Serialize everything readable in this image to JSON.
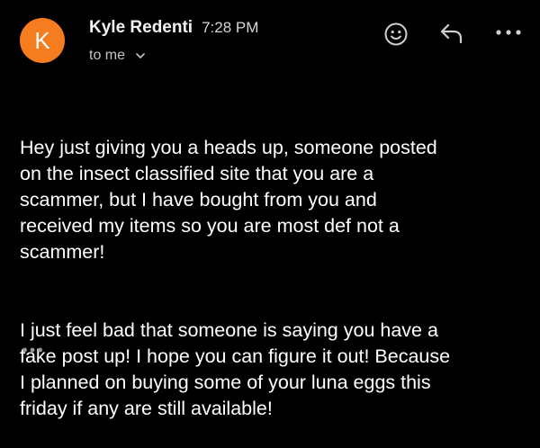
{
  "colors": {
    "avatar_bg": "#f57c1f",
    "background": "#000000",
    "text": "#ffffff",
    "secondary_text": "#c4c4c4",
    "icon": "#cfcfcf"
  },
  "message": {
    "avatar_initial": "K",
    "sender_name": "Kyle Redenti",
    "time": "7:28 PM",
    "recipient_label": "to me",
    "recipient_chevron_icon": "chevron-down-icon",
    "actions": {
      "emoji_icon": "smiley-icon",
      "reply_icon": "reply-arrow-icon",
      "more_icon": "more-horizontal-icon"
    },
    "body_paragraphs": [
      "Hey just giving you a heads up, someone posted\non the insect classified site that you are a\nscammer, but I have bought from you and\nreceived my items so you are most def not a\nscammer!",
      "I just feel bad that someone is saying you have a\nfake post up! I hope you can figure it out! Because\nI planned on buying some of your luna eggs this\nfriday if any are still available!"
    ],
    "trimmed_content_icon": "ellipsis-icon"
  }
}
